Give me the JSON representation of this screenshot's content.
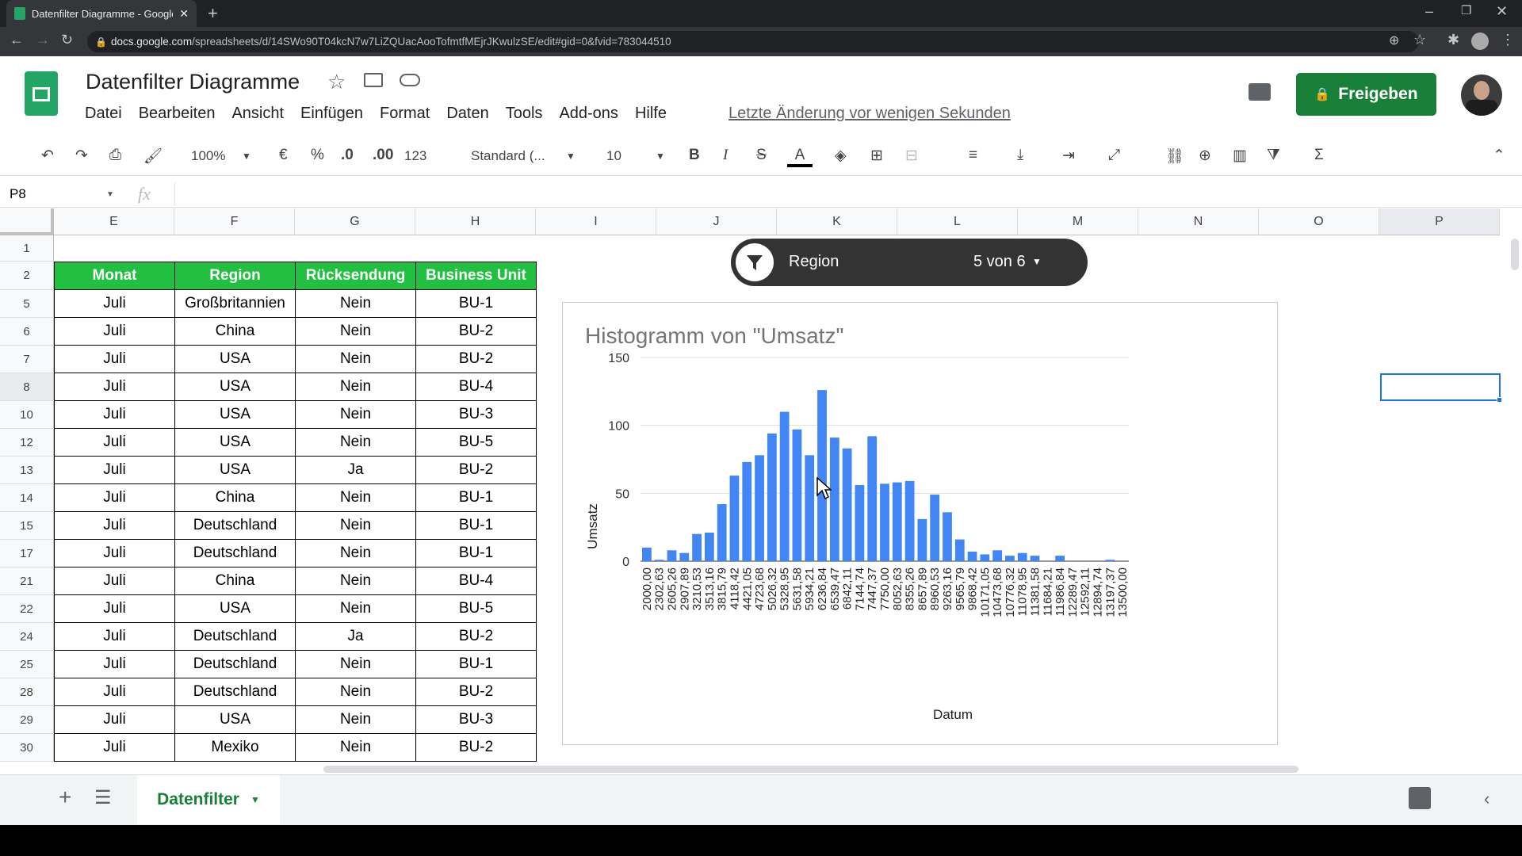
{
  "browser": {
    "tab_title": "Datenfilter Diagramme - Google...",
    "url_host": "docs.google.com",
    "url_path": "/spreadsheets/d/14SWo90T04kcN7w7LiZQUacAooTofmtfMEjrJKwulzSE/edit#gid=0&fvid=783044510"
  },
  "doc": {
    "title": "Datenfilter Diagramme",
    "menu": [
      "Datei",
      "Bearbeiten",
      "Ansicht",
      "Einfügen",
      "Format",
      "Daten",
      "Tools",
      "Add-ons",
      "Hilfe"
    ],
    "last_change": "Letzte Änderung vor wenigen Sekunden",
    "share_label": "Freigeben"
  },
  "toolbar": {
    "zoom": "100%",
    "currency": "€",
    "percent": "%",
    "dec_less": ".0",
    "dec_more": ".00",
    "format_more": "123",
    "font": "Standard (...",
    "font_size": "10"
  },
  "formula_bar": {
    "cell_ref": "P8",
    "fx": "fx"
  },
  "columns": [
    "E",
    "F",
    "G",
    "H",
    "I",
    "J",
    "K",
    "L",
    "M",
    "N",
    "O",
    "P"
  ],
  "row_numbers": [
    "1",
    "2",
    "5",
    "6",
    "7",
    "8",
    "10",
    "12",
    "13",
    "14",
    "15",
    "17",
    "21",
    "22",
    "24",
    "25",
    "28",
    "29",
    "30"
  ],
  "table": {
    "headers": [
      "Monat",
      "Region",
      "Rücksendung",
      "Business Unit"
    ],
    "rows": [
      [
        "Juli",
        "Großbritannien",
        "Nein",
        "BU-1"
      ],
      [
        "Juli",
        "China",
        "Nein",
        "BU-2"
      ],
      [
        "Juli",
        "USA",
        "Nein",
        "BU-2"
      ],
      [
        "Juli",
        "USA",
        "Nein",
        "BU-4"
      ],
      [
        "Juli",
        "USA",
        "Nein",
        "BU-3"
      ],
      [
        "Juli",
        "USA",
        "Nein",
        "BU-5"
      ],
      [
        "Juli",
        "USA",
        "Ja",
        "BU-2"
      ],
      [
        "Juli",
        "China",
        "Nein",
        "BU-1"
      ],
      [
        "Juli",
        "Deutschland",
        "Nein",
        "BU-1"
      ],
      [
        "Juli",
        "Deutschland",
        "Nein",
        "BU-1"
      ],
      [
        "Juli",
        "China",
        "Nein",
        "BU-4"
      ],
      [
        "Juli",
        "USA",
        "Nein",
        "BU-5"
      ],
      [
        "Juli",
        "Deutschland",
        "Ja",
        "BU-2"
      ],
      [
        "Juli",
        "Deutschland",
        "Nein",
        "BU-1"
      ],
      [
        "Juli",
        "Deutschland",
        "Nein",
        "BU-2"
      ],
      [
        "Juli",
        "USA",
        "Nein",
        "BU-3"
      ],
      [
        "Juli",
        "Mexiko",
        "Nein",
        "BU-2"
      ]
    ]
  },
  "filter_chip": {
    "label": "Region",
    "value": "5 von 6"
  },
  "chart_data": {
    "type": "bar",
    "title": "Histogramm von \"Umsatz\"",
    "xlabel": "Datum",
    "ylabel": "Umsatz",
    "ylim": [
      0,
      150
    ],
    "yticks": [
      "0",
      "50",
      "100",
      "150"
    ],
    "bar_color": "#4285f4",
    "grid": true,
    "categories": [
      "2000,00",
      "2302,63",
      "2605,26",
      "2907,89",
      "3210,53",
      "3513,16",
      "3815,79",
      "4118,42",
      "4421,05",
      "4723,68",
      "5026,32",
      "5328,95",
      "5631,58",
      "5934,21",
      "6236,84",
      "6539,47",
      "6842,11",
      "7144,74",
      "7447,37",
      "7750,00",
      "8052,63",
      "8355,26",
      "8657,89",
      "8960,53",
      "9263,16",
      "9565,79",
      "9868,42",
      "10171,05",
      "10473,68",
      "10776,32",
      "11078,95",
      "11381,58",
      "11684,21",
      "11986,84",
      "12289,47",
      "12592,11",
      "12894,74",
      "13197,37",
      "13500,00"
    ],
    "values": [
      10,
      1,
      8,
      6,
      20,
      21,
      42,
      63,
      73,
      78,
      94,
      110,
      97,
      78,
      126,
      91,
      83,
      56,
      92,
      57,
      58,
      59,
      31,
      49,
      36,
      16,
      7,
      5,
      8,
      4,
      6,
      4,
      0,
      4,
      0,
      0,
      0,
      1,
      0
    ]
  },
  "sheet": {
    "tab_label": "Datenfilter"
  }
}
